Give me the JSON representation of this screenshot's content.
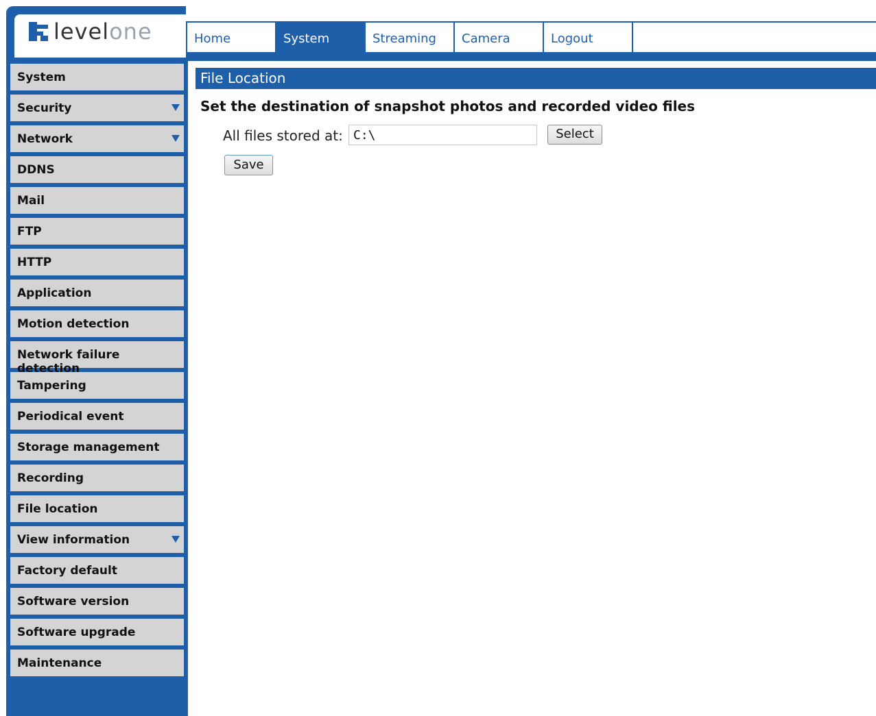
{
  "brand": {
    "name_part1": "level",
    "name_part2": "one"
  },
  "top_nav": {
    "tabs": [
      {
        "label": "Home",
        "active": false
      },
      {
        "label": "System",
        "active": true
      },
      {
        "label": "Streaming",
        "active": false
      },
      {
        "label": "Camera",
        "active": false
      },
      {
        "label": "Logout",
        "active": false
      }
    ]
  },
  "sidebar": {
    "items": [
      {
        "label": "System",
        "has_submenu": false
      },
      {
        "label": "Security",
        "has_submenu": true
      },
      {
        "label": "Network",
        "has_submenu": true
      },
      {
        "label": "DDNS",
        "has_submenu": false
      },
      {
        "label": "Mail",
        "has_submenu": false
      },
      {
        "label": "FTP",
        "has_submenu": false
      },
      {
        "label": "HTTP",
        "has_submenu": false
      },
      {
        "label": "Application",
        "has_submenu": false
      },
      {
        "label": "Motion detection",
        "has_submenu": false
      },
      {
        "label": "Network failure detection",
        "has_submenu": false
      },
      {
        "label": "Tampering",
        "has_submenu": false
      },
      {
        "label": "Periodical event",
        "has_submenu": false
      },
      {
        "label": "Storage management",
        "has_submenu": false
      },
      {
        "label": "Recording",
        "has_submenu": false
      },
      {
        "label": "File location",
        "has_submenu": false
      },
      {
        "label": "View information",
        "has_submenu": true
      },
      {
        "label": "Factory default",
        "has_submenu": false
      },
      {
        "label": "Software version",
        "has_submenu": false
      },
      {
        "label": "Software upgrade",
        "has_submenu": false
      },
      {
        "label": "Maintenance",
        "has_submenu": false
      }
    ]
  },
  "main": {
    "title": "File Location",
    "subtitle": "Set the destination of snapshot photos and recorded video files",
    "field_label": "All files stored at:",
    "path_value": "C:\\",
    "select_label": "Select",
    "save_label": "Save"
  },
  "colors": {
    "accent": "#1f5ea8",
    "sidebar_item_bg": "#d4d4d4"
  }
}
